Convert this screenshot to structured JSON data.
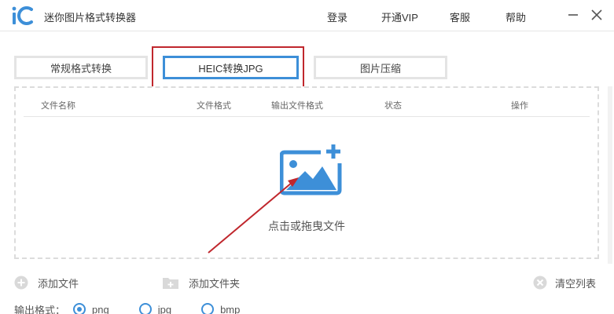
{
  "app": {
    "title": "迷你图片格式转换器"
  },
  "nav": {
    "login": "登录",
    "vip": "开通VIP",
    "service": "客服",
    "help": "帮助"
  },
  "tabs": [
    {
      "label": "常规格式转换",
      "active": false
    },
    {
      "label": "HEIC转换JPG",
      "active": true
    },
    {
      "label": "图片压缩",
      "active": false
    }
  ],
  "table": {
    "columns": [
      "文件名称",
      "文件格式",
      "输出文件格式",
      "状态",
      "操作"
    ]
  },
  "dropzone": {
    "hint": "点击或拖曳文件"
  },
  "actions": {
    "add_file": "添加文件",
    "add_folder": "添加文件夹",
    "clear_list": "清空列表"
  },
  "output": {
    "label": "输出格式：",
    "options": [
      "png",
      "jpg",
      "bmp"
    ],
    "selected": "png"
  },
  "colors": {
    "accent": "#3d8fd8",
    "highlight": "#c0272d",
    "border": "#e4e4e4"
  }
}
